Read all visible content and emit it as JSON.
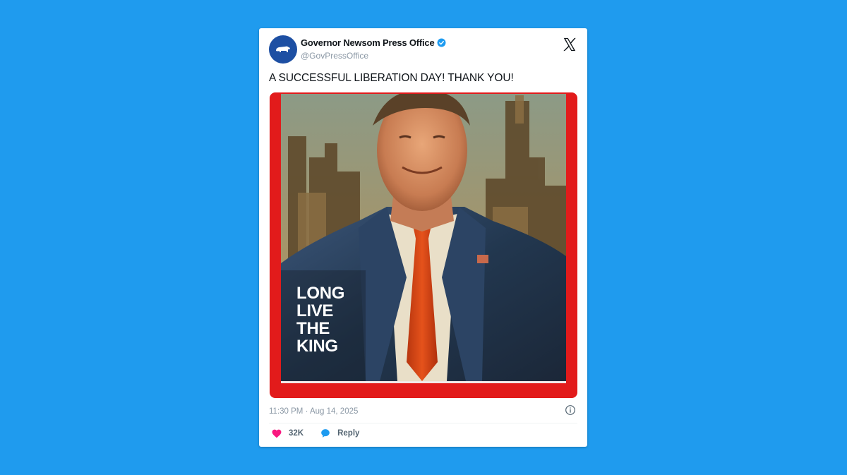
{
  "post": {
    "display_name": "Governor Newsom Press Office",
    "handle": "@GovPressOffice",
    "verified": true,
    "text": "A SUCCESSFUL LIBERATION DAY! THANK YOU!",
    "image_caption_lines": [
      "LONG",
      "LIVE",
      "THE",
      "KING"
    ],
    "timestamp": "11:30 PM · Aug 14, 2025",
    "likes": "32K",
    "reply_label": "Reply"
  },
  "icons": {
    "avatar": "california-bear-icon",
    "verified": "verified-badge-icon",
    "platform": "x-logo-icon",
    "info": "info-icon",
    "like": "heart-icon",
    "reply": "speech-bubble-icon"
  },
  "colors": {
    "background": "#1f9bee",
    "card": "#ffffff",
    "media_frame": "#e21b1b",
    "verified": "#1d9bf0",
    "heart": "#f91880",
    "reply_bubble": "#1d9bf0"
  }
}
